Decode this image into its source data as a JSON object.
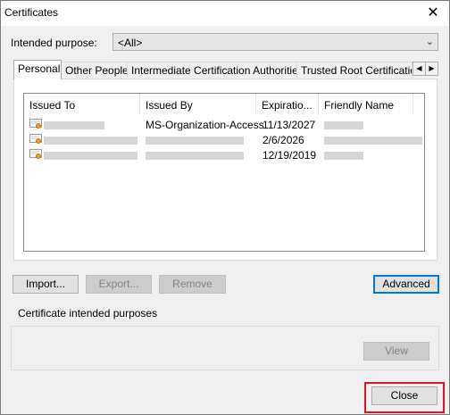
{
  "window": {
    "title": "Certificates",
    "close_glyph": "✕"
  },
  "purpose": {
    "label": "Intended purpose:",
    "value": "<All>"
  },
  "tabs": [
    {
      "label": "Personal"
    },
    {
      "label": "Other People"
    },
    {
      "label": "Intermediate Certification Authorities"
    },
    {
      "label": "Trusted Root Certification"
    }
  ],
  "tab_scroll": {
    "left": "◀",
    "right": "▶"
  },
  "table": {
    "columns": [
      "Issued To",
      "Issued By",
      "Expiratio...",
      "Friendly Name"
    ],
    "rows": [
      {
        "issued_by": "MS-Organization-Access",
        "expiration": "11/13/2027"
      },
      {
        "issued_by": "",
        "expiration": "2/6/2026"
      },
      {
        "issued_by": "",
        "expiration": "12/19/2019"
      }
    ]
  },
  "buttons": {
    "import": "Import...",
    "export": "Export...",
    "remove": "Remove",
    "advanced": "Advanced",
    "view": "View",
    "close": "Close"
  },
  "group": {
    "label": "Certificate intended purposes"
  },
  "colors": {
    "accent": "#0078d7",
    "highlight": "#e81123"
  }
}
